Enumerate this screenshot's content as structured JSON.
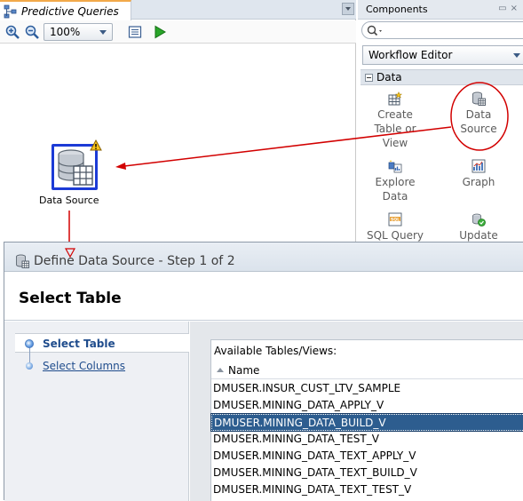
{
  "editor": {
    "tab_title": "Predictive Queries",
    "zoom_value": "100%",
    "node_label": "Data Source"
  },
  "components": {
    "title": "Components",
    "search_placeholder": "",
    "palette_selector": "Workflow Editor",
    "section_label": "Data",
    "items": [
      {
        "label": "Create\nTable or\nView",
        "icon": "create-table-icon"
      },
      {
        "label": "Data\nSource",
        "icon": "data-source-icon"
      },
      {
        "label": "Explore\nData",
        "icon": "explore-data-icon"
      },
      {
        "label": "Graph",
        "icon": "graph-icon"
      },
      {
        "label": "SQL Query",
        "icon": "sql-query-icon"
      },
      {
        "label": "Update",
        "icon": "update-icon"
      }
    ]
  },
  "dialog": {
    "title": "Define Data Source - Step 1 of 2",
    "header": "Select Table",
    "steps": [
      {
        "label": "Select Table",
        "active": true
      },
      {
        "label": "Select Columns",
        "active": false
      }
    ],
    "table": {
      "caption": "Available Tables/Views:",
      "column_header": "Name",
      "rows": [
        "DMUSER.INSUR_CUST_LTV_SAMPLE",
        "DMUSER.MINING_DATA_APPLY_V",
        "DMUSER.MINING_DATA_BUILD_V",
        "DMUSER.MINING_DATA_TEST_V",
        "DMUSER.MINING_DATA_TEXT_APPLY_V",
        "DMUSER.MINING_DATA_TEXT_BUILD_V",
        "DMUSER.MINING_DATA_TEXT_TEST_V"
      ],
      "selected_index": 2
    }
  },
  "colors": {
    "annotation_red": "#d20000",
    "selection_blue": "#2d5d8f",
    "node_border_blue": "#1c3bd6"
  }
}
